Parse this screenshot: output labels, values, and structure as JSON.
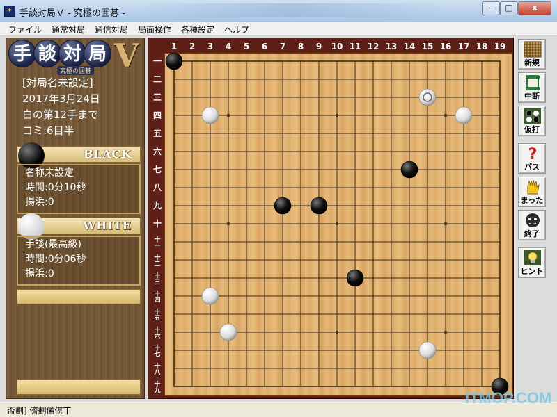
{
  "window": {
    "title": "手談対局Ｖ - 究極の囲碁 -",
    "buttons": {
      "minimize": "–",
      "maximize": "□",
      "close": "x"
    }
  },
  "menu": [
    "ファイル",
    "通常対局",
    "通信対局",
    "局面操作",
    "各種設定",
    "ヘルプ"
  ],
  "logo": {
    "chars": [
      "手",
      "談",
      "対",
      "局"
    ],
    "version": "V",
    "subtitle": "究極の囲碁"
  },
  "game_info": {
    "title": "[対局名未設定]",
    "date": "2017年3月24日",
    "move_status": "白の第12手まで",
    "komi": "コミ:6目半"
  },
  "black": {
    "label": "BLACK",
    "name": "名称未設定",
    "time": "時間:0分10秒",
    "captures": "揚浜:0"
  },
  "white": {
    "label": "WHITE",
    "name": "手談(最高級)",
    "time": "時間:0分06秒",
    "captures": "揚浜:0"
  },
  "board": {
    "size": 19,
    "col_labels": [
      "1",
      "2",
      "3",
      "4",
      "5",
      "6",
      "7",
      "8",
      "9",
      "10",
      "11",
      "12",
      "13",
      "14",
      "15",
      "16",
      "17",
      "18",
      "19"
    ],
    "row_labels": [
      "一",
      "二",
      "三",
      "四",
      "五",
      "六",
      "七",
      "八",
      "九",
      "十",
      "十一",
      "十二",
      "十三",
      "十四",
      "十五",
      "十六",
      "十七",
      "十八",
      "十九"
    ],
    "stones": [
      {
        "color": "black",
        "col": 1,
        "row": 1
      },
      {
        "color": "white",
        "col": 15,
        "row": 3,
        "last_move": true
      },
      {
        "color": "white",
        "col": 3,
        "row": 4
      },
      {
        "color": "white",
        "col": 17,
        "row": 4
      },
      {
        "color": "black",
        "col": 14,
        "row": 7
      },
      {
        "color": "black",
        "col": 7,
        "row": 9
      },
      {
        "color": "black",
        "col": 9,
        "row": 9
      },
      {
        "color": "black",
        "col": 11,
        "row": 13
      },
      {
        "color": "white",
        "col": 3,
        "row": 14
      },
      {
        "color": "white",
        "col": 4,
        "row": 16
      },
      {
        "color": "white",
        "col": 15,
        "row": 17
      },
      {
        "color": "black",
        "col": 19,
        "row": 19
      }
    ],
    "colors": {
      "frame": "#5e1f16",
      "wood": "#e2b272",
      "line": "#3a2a18",
      "label": "#ffffff"
    }
  },
  "toolbar": [
    {
      "id": "new",
      "label": "新規",
      "icon": "grid-icon"
    },
    {
      "id": "suspend",
      "label": "中断",
      "icon": "scroll-icon"
    },
    {
      "id": "trial",
      "label": "仮打",
      "icon": "stones-icon"
    },
    {
      "id": "pass",
      "label": "パス",
      "icon": "question-icon"
    },
    {
      "id": "undo",
      "label": "まった",
      "icon": "hand-icon"
    },
    {
      "id": "end",
      "label": "終了",
      "icon": "face-icon"
    },
    {
      "id": "hint",
      "label": "ヒント",
      "icon": "bulb-icon"
    }
  ],
  "status": "盃劃]  儕劃儖偡丅",
  "watermark": "ITMOP.COM"
}
